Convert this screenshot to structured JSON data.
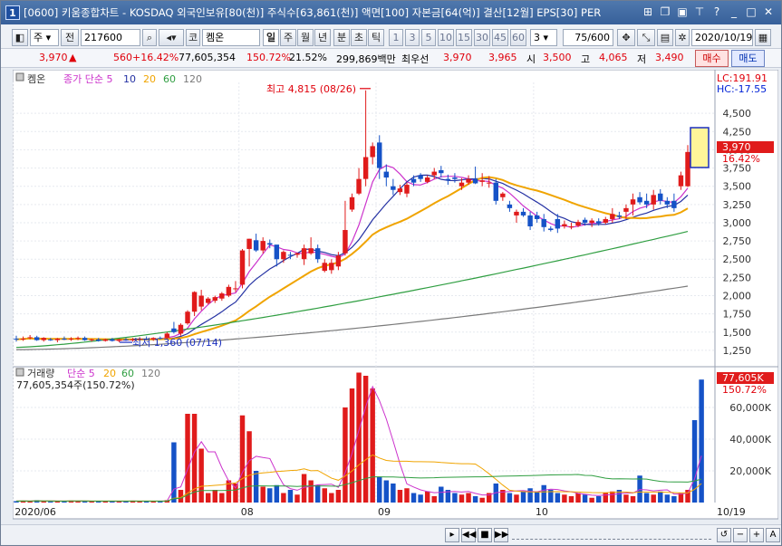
{
  "window": {
    "title": "[0600] 키움종합차트 - KOSDAQ 외국인보유[80(천)] 주식수[63,861(천)] 액면[100] 자본금[64(억)] 결산[12월] EPS[30] PER",
    "app_number": "1",
    "title_icons": [
      "tile-icon",
      "restore-icon",
      "lock-icon",
      "pin-icon",
      "help-icon",
      "minimize-icon",
      "maximize-icon",
      "close-icon"
    ]
  },
  "toolbar": {
    "type_label": "주",
    "prev_label": "전",
    "code": "217600",
    "market_label": "코",
    "name": "켐온",
    "periods": [
      "일",
      "주",
      "월",
      "년",
      "분",
      "초",
      "틱"
    ],
    "selected_period": "일",
    "minute_options": [
      "1",
      "3",
      "5",
      "10",
      "15",
      "30",
      "45",
      "60"
    ],
    "interval_value": "3",
    "count": "75/600",
    "date": "2020/10/19"
  },
  "quote": {
    "price": "3,970",
    "change_arrow": "▲",
    "change": "560",
    "change_pct": "+16.42%",
    "volume": "77,605,354",
    "volume_ratio": "150.72%",
    "turnover": "21.52%",
    "amount": "299,869백만",
    "priority_label": "최우선",
    "best_ask": "3,970",
    "best_bid": "3,965",
    "open_label": "시",
    "open": "3,500",
    "high_label": "고",
    "high": "4,065",
    "low_label": "저",
    "low": "3,490",
    "buy_label": "매수",
    "sell_label": "매도"
  },
  "chart_data": [
    {
      "type": "candlestick",
      "name": "켐온",
      "legend": [
        "켐온",
        "종가 단순 5",
        "10",
        "20",
        "60",
        "120"
      ],
      "x_period": "2020/06/18 – 2020/10/19 (daily)",
      "y_ticks": [
        1250,
        1500,
        1750,
        2000,
        2250,
        2500,
        2750,
        3000,
        3250,
        3500,
        3750,
        4000,
        4250,
        4500
      ],
      "ylim": [
        1100,
        4800
      ],
      "price_label": "3,970",
      "change_label": "16.42%",
      "lc_label": "LC:191.91",
      "hc_label": "HC:-17.55",
      "annotations": [
        {
          "label": "최고 4,815 (08/26)",
          "value": 4815
        },
        {
          "label": "최저 1,360 (07/14)",
          "value": 1360
        }
      ],
      "candles_ohlc": [
        [
          1410,
          1450,
          1370,
          1400
        ],
        [
          1400,
          1440,
          1380,
          1410
        ],
        [
          1420,
          1460,
          1400,
          1430
        ],
        [
          1430,
          1450,
          1380,
          1390
        ],
        [
          1390,
          1430,
          1370,
          1420
        ],
        [
          1400,
          1420,
          1380,
          1390
        ],
        [
          1390,
          1420,
          1360,
          1410
        ],
        [
          1410,
          1440,
          1390,
          1400
        ],
        [
          1400,
          1430,
          1380,
          1410
        ],
        [
          1410,
          1440,
          1390,
          1420
        ],
        [
          1420,
          1440,
          1380,
          1390
        ],
        [
          1390,
          1410,
          1370,
          1400
        ],
        [
          1400,
          1420,
          1370,
          1380
        ],
        [
          1380,
          1410,
          1370,
          1400
        ],
        [
          1400,
          1420,
          1370,
          1380
        ],
        [
          1380,
          1410,
          1360,
          1400
        ],
        [
          1400,
          1420,
          1380,
          1390
        ],
        [
          1390,
          1420,
          1370,
          1400
        ],
        [
          1400,
          1430,
          1380,
          1410
        ],
        [
          1410,
          1440,
          1390,
          1400
        ],
        [
          1400,
          1430,
          1380,
          1420
        ],
        [
          1420,
          1440,
          1400,
          1410
        ],
        [
          1420,
          1500,
          1410,
          1480
        ],
        [
          1550,
          1640,
          1480,
          1500
        ],
        [
          1480,
          1620,
          1450,
          1600
        ],
        [
          1620,
          1800,
          1600,
          1780
        ],
        [
          1780,
          2060,
          1720,
          2050
        ],
        [
          1850,
          2080,
          1800,
          2000
        ],
        [
          1900,
          1980,
          1880,
          1960
        ],
        [
          1930,
          2000,
          1900,
          1980
        ],
        [
          1960,
          2050,
          1930,
          2030
        ],
        [
          2000,
          2150,
          1980,
          2120
        ],
        [
          2100,
          2200,
          2050,
          2100
        ],
        [
          2150,
          2640,
          2100,
          2620
        ],
        [
          2640,
          2780,
          2400,
          2780
        ],
        [
          2760,
          2850,
          2600,
          2620
        ],
        [
          2620,
          2800,
          2580,
          2750
        ],
        [
          2720,
          2770,
          2650,
          2700
        ],
        [
          2700,
          2600,
          2400,
          2500
        ],
        [
          2500,
          2620,
          2450,
          2600
        ],
        [
          2560,
          2600,
          2500,
          2550
        ],
        [
          2560,
          2590,
          2520,
          2580
        ],
        [
          2500,
          2700,
          2420,
          2650
        ],
        [
          2580,
          2800,
          2560,
          2650
        ],
        [
          2650,
          2700,
          2450,
          2500
        ],
        [
          2340,
          2500,
          2320,
          2450
        ],
        [
          2350,
          2500,
          2300,
          2450
        ],
        [
          2400,
          2600,
          2350,
          2550
        ],
        [
          2580,
          3300,
          2550,
          2900
        ],
        [
          3180,
          3400,
          3150,
          3350
        ],
        [
          3400,
          3750,
          3380,
          3600
        ],
        [
          3600,
          4815,
          3500,
          3900
        ],
        [
          3900,
          4100,
          3800,
          4050
        ],
        [
          4100,
          4200,
          3600,
          3750
        ],
        [
          3700,
          3800,
          3500,
          3620
        ],
        [
          3500,
          3600,
          3380,
          3450
        ],
        [
          3420,
          3520,
          3380,
          3470
        ],
        [
          3400,
          3550,
          3350,
          3520
        ],
        [
          3600,
          3650,
          3500,
          3550
        ],
        [
          3650,
          3680,
          3560,
          3600
        ],
        [
          3560,
          3650,
          3540,
          3620
        ],
        [
          3650,
          3750,
          3600,
          3700
        ],
        [
          3720,
          3780,
          3620,
          3680
        ],
        [
          3600,
          3660,
          3520,
          3580
        ],
        [
          3620,
          3680,
          3550,
          3600
        ],
        [
          3500,
          3610,
          3450,
          3550
        ],
        [
          3550,
          3650,
          3520,
          3600
        ],
        [
          3600,
          3770,
          3530,
          3540
        ],
        [
          3560,
          3680,
          3500,
          3580
        ],
        [
          3540,
          3640,
          3480,
          3550
        ],
        [
          3550,
          3600,
          3250,
          3300
        ],
        [
          3350,
          3420,
          3300,
          3400
        ],
        [
          3250,
          3300,
          3150,
          3200
        ],
        [
          3100,
          3180,
          3000,
          3150
        ],
        [
          3150,
          3200,
          3080,
          3100
        ],
        [
          3100,
          3150,
          2900,
          2950
        ],
        [
          3100,
          3150,
          3000,
          3050
        ],
        [
          3050,
          3120,
          2880,
          2940
        ],
        [
          2920,
          2950,
          2880,
          2900
        ],
        [
          3050,
          3120,
          2860,
          2920
        ],
        [
          2950,
          3030,
          2920,
          2980
        ],
        [
          2940,
          3000,
          2910,
          2950
        ],
        [
          2960,
          3040,
          2940,
          3010
        ],
        [
          3040,
          3070,
          2960,
          3000
        ],
        [
          3000,
          3060,
          2940,
          3030
        ],
        [
          3020,
          3060,
          2960,
          2990
        ],
        [
          3000,
          3080,
          2980,
          3050
        ],
        [
          3050,
          3200,
          3000,
          3120
        ],
        [
          3100,
          3150,
          3050,
          3080
        ],
        [
          3150,
          3250,
          3050,
          3200
        ],
        [
          3250,
          3400,
          3100,
          3320
        ],
        [
          3350,
          3420,
          3250,
          3280
        ],
        [
          3300,
          3400,
          3200,
          3250
        ],
        [
          3250,
          3450,
          3180,
          3380
        ],
        [
          3400,
          3460,
          3250,
          3300
        ],
        [
          3300,
          3350,
          3200,
          3250
        ],
        [
          3300,
          3400,
          3150,
          3200
        ],
        [
          3500,
          3700,
          3450,
          3650
        ],
        [
          3500,
          4065,
          3490,
          3970
        ]
      ],
      "ma_series": [
        {
          "name": "5",
          "end_value": 3350
        },
        {
          "name": "10",
          "end_value": 3220
        },
        {
          "name": "20",
          "end_value": 3160
        },
        {
          "name": "60",
          "end_value": 2880
        },
        {
          "name": "120",
          "end_value": 2130
        }
      ]
    },
    {
      "type": "bar",
      "name": "거래량",
      "legend": [
        "거래량",
        "단순 5",
        "20",
        "60",
        "120"
      ],
      "value_label": "77,605,354주(150.72%)",
      "y_ticks": [
        "20,000K",
        "40,000K",
        "60,000K"
      ],
      "y_tick_values": [
        20000,
        40000,
        60000
      ],
      "ylim": [
        0,
        80000
      ],
      "last_label": "77,605K",
      "last_pct": "150.72%",
      "unit": "K (천주)",
      "values_k": [
        900,
        1200,
        700,
        1500,
        800,
        600,
        900,
        700,
        1300,
        1000,
        800,
        600,
        700,
        1100,
        800,
        900,
        600,
        1200,
        800,
        700,
        900,
        1100,
        1500,
        38000,
        8000,
        56000,
        56000,
        34000,
        6000,
        8000,
        6000,
        14000,
        12000,
        55000,
        45000,
        20000,
        10000,
        9000,
        11000,
        6000,
        8000,
        5000,
        18000,
        14000,
        11000,
        9000,
        6000,
        8000,
        60000,
        72000,
        82000,
        80000,
        72000,
        16000,
        14000,
        12000,
        8000,
        9000,
        6000,
        5000,
        7000,
        4000,
        10000,
        8000,
        6000,
        5000,
        6000,
        4000,
        3000,
        6000,
        12000,
        8000,
        6000,
        5000,
        7000,
        9000,
        7000,
        11000,
        8000,
        6000,
        5000,
        4000,
        6000,
        5000,
        3000,
        4000,
        6000,
        7000,
        8000,
        5000,
        4000,
        17000,
        6000,
        5000,
        7000,
        5000,
        4000,
        6000,
        8000,
        52000,
        77605
      ]
    }
  ],
  "x_axis": {
    "labels": [
      "2020/06",
      "08",
      "09",
      "10",
      "10/19"
    ]
  },
  "colors": {
    "up": "#e01b1b",
    "down": "#1552c7",
    "ma5": "#cc33cc",
    "ma10": "#2431a3",
    "ma20": "#f0a400",
    "ma60": "#2f9e41",
    "ma120": "#7a7a7a"
  }
}
